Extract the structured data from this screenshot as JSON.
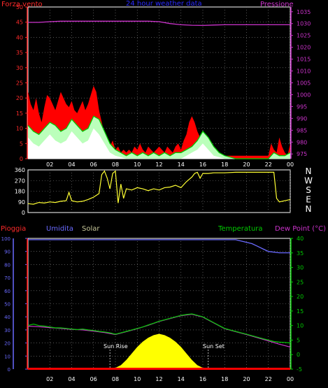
{
  "chart_data": [
    {
      "type": "line",
      "title": "24 hour weather data",
      "left_axis_label": "Forza vento",
      "right_axis_label": "Pressione",
      "x_tick_labels": [
        "02",
        "04",
        "06",
        "08",
        "10",
        "12",
        "14",
        "16",
        "18",
        "20",
        "22",
        "00"
      ],
      "left_ticks": [
        0,
        5,
        10,
        15,
        20,
        25,
        30,
        35,
        40,
        45,
        50
      ],
      "right_ticks": [
        975,
        980,
        985,
        990,
        995,
        1000,
        1005,
        1010,
        1015,
        1020,
        1025,
        1030,
        1035
      ],
      "xlim": [
        0,
        24
      ],
      "ylim_left": [
        0,
        50
      ],
      "ylim_right": [
        973,
        1037
      ],
      "grid": true,
      "colors": {
        "gust": "#ff0000",
        "average": "#00cc00",
        "min": "#ffffff",
        "pressure": "#cc33cc",
        "left_axis": "#ff2a2a",
        "right_axis": "#cc33cc",
        "title": "#2a2aff"
      },
      "series": [
        {
          "role": "gust",
          "x": [
            0,
            0.25,
            0.5,
            0.75,
            1,
            1.25,
            1.5,
            1.75,
            2,
            2.25,
            2.5,
            2.75,
            3,
            3.25,
            3.5,
            3.75,
            4,
            4.25,
            4.5,
            4.75,
            5,
            5.25,
            5.5,
            5.75,
            6,
            6.25,
            6.5,
            6.75,
            7,
            7.25,
            7.5,
            7.75,
            8,
            8.25,
            8.5,
            8.75,
            9,
            9.25,
            9.5,
            9.75,
            10,
            10.25,
            10.5,
            10.75,
            11,
            11.25,
            11.5,
            11.75,
            12,
            12.25,
            12.5,
            12.75,
            13,
            13.25,
            13.5,
            13.75,
            14,
            14.25,
            14.5,
            14.75,
            15,
            15.25,
            15.5,
            15.75,
            16,
            16.25,
            16.5,
            16.75,
            17,
            17.25,
            17.5,
            17.75,
            18,
            18.5,
            19,
            19.5,
            20,
            20.5,
            21,
            21.5,
            22,
            22.25,
            22.5,
            22.75,
            23,
            23.25,
            23.5,
            23.75,
            24
          ],
          "values": [
            22,
            18,
            16,
            20,
            15,
            12,
            17,
            21,
            20,
            18,
            16,
            19,
            22,
            20,
            18,
            17,
            19,
            16,
            15,
            17,
            19,
            16,
            18,
            21,
            24,
            22,
            16,
            12,
            8,
            5,
            4,
            6,
            3,
            4,
            2,
            3,
            2,
            3,
            2,
            4,
            3,
            5,
            3,
            2,
            4,
            3,
            2,
            3,
            4,
            3,
            2,
            4,
            3,
            2,
            4,
            5,
            3,
            6,
            8,
            12,
            14,
            12,
            9,
            7,
            6,
            5,
            3,
            2,
            1,
            1,
            1,
            1,
            1,
            1,
            1,
            1,
            1,
            1,
            1,
            1,
            1,
            5,
            3,
            2,
            7,
            4,
            2,
            1,
            5
          ]
        },
        {
          "role": "average",
          "x": [
            0,
            0.5,
            1,
            1.5,
            2,
            2.5,
            3,
            3.5,
            4,
            4.5,
            5,
            5.5,
            6,
            6.5,
            7,
            7.5,
            8,
            8.5,
            9,
            9.5,
            10,
            10.5,
            11,
            11.5,
            12,
            12.5,
            13,
            13.5,
            14,
            14.5,
            15,
            15.5,
            16,
            16.5,
            17,
            17.5,
            18,
            19,
            20,
            21,
            22,
            22.5,
            23,
            23.5,
            24
          ],
          "values": [
            11,
            9,
            8,
            10,
            12,
            11,
            9,
            10,
            13,
            11,
            9,
            10,
            14,
            13,
            9,
            5,
            3,
            2,
            1,
            2,
            1,
            2,
            1,
            2,
            1,
            2,
            1,
            2,
            2,
            3,
            4,
            6,
            9,
            7,
            4,
            2,
            1,
            0,
            0,
            0,
            0,
            2,
            1,
            1,
            2
          ]
        },
        {
          "role": "min",
          "x": [
            0,
            0.5,
            1,
            1.5,
            2,
            2.5,
            3,
            3.5,
            4,
            4.5,
            5,
            5.5,
            6,
            6.5,
            7,
            7.5,
            8,
            9,
            10,
            11,
            12,
            13,
            14,
            14.5,
            15,
            15.5,
            16,
            16.5,
            17,
            18,
            20,
            22,
            23,
            24
          ],
          "values": [
            7,
            5,
            4,
            6,
            8,
            6,
            5,
            6,
            9,
            7,
            5,
            6,
            10,
            8,
            5,
            2,
            1,
            0,
            0,
            0,
            0,
            0,
            0,
            1,
            2,
            3,
            5,
            3,
            1,
            0,
            0,
            0,
            0,
            0
          ]
        },
        {
          "role": "pressure",
          "x": [
            0,
            1,
            2,
            3,
            4,
            5,
            6,
            7,
            8,
            9,
            10,
            11,
            12,
            13,
            14,
            15,
            16,
            17,
            18,
            19,
            20,
            21,
            22,
            23,
            24
          ],
          "values": [
            1030.5,
            1030.5,
            1030.8,
            1031,
            1031,
            1031,
            1031,
            1031,
            1031,
            1031,
            1031,
            1031,
            1030.8,
            1030,
            1029.5,
            1029.3,
            1029.2,
            1029.4,
            1029.5,
            1029.5,
            1029.5,
            1029.5,
            1029.5,
            1029.5,
            1029.5
          ]
        }
      ]
    },
    {
      "type": "line",
      "side_labels": [
        "N",
        "W",
        "S",
        "E",
        "N"
      ],
      "left_ticks": [
        0,
        90,
        180,
        270,
        360
      ],
      "x_tick_labels": [
        "02",
        "04",
        "06",
        "08",
        "10",
        "12",
        "14",
        "16",
        "18",
        "20",
        "22",
        "00"
      ],
      "xlim": [
        0,
        24
      ],
      "ylim": [
        0,
        360
      ],
      "grid": true,
      "colors": {
        "direction": "#ffff33",
        "axis": "#ffffff",
        "letters": "#ffffff"
      },
      "series": [
        {
          "role": "wind_direction_degrees",
          "x": [
            0,
            0.5,
            1,
            1.5,
            2,
            2.5,
            3,
            3.5,
            3.75,
            4,
            4.5,
            5,
            5.5,
            6,
            6.5,
            6.75,
            7,
            7.25,
            7.5,
            7.75,
            8,
            8.25,
            8.5,
            8.75,
            9,
            9.5,
            10,
            10.5,
            11,
            11.5,
            12,
            12.5,
            13,
            13.5,
            14,
            14.5,
            15,
            15.25,
            15.5,
            15.75,
            16,
            16.5,
            17,
            18,
            19,
            20,
            21,
            22,
            22.5,
            22.75,
            23,
            23.5,
            24
          ],
          "values": [
            75,
            70,
            85,
            80,
            90,
            85,
            95,
            100,
            170,
            100,
            90,
            95,
            110,
            130,
            160,
            320,
            350,
            290,
            200,
            330,
            350,
            80,
            240,
            120,
            200,
            190,
            210,
            200,
            185,
            200,
            190,
            210,
            215,
            230,
            210,
            260,
            300,
            330,
            340,
            290,
            330,
            330,
            335,
            335,
            340,
            340,
            340,
            340,
            340,
            120,
            90,
            100,
            110
          ]
        }
      ]
    },
    {
      "type": "area",
      "labels": {
        "pioggia": "Pioggia",
        "umidita": "Umidita",
        "solar": "Solar",
        "temperatura": "Temperatura",
        "dew_point": "Dew Point (°C)",
        "sun_rise": "Sun Rise",
        "sun_set": "Sun Set"
      },
      "left_ticks": [
        0,
        10,
        20,
        30,
        40,
        50,
        60,
        70,
        80,
        90,
        100
      ],
      "right_ticks": [
        -5,
        0,
        5,
        10,
        15,
        20,
        25,
        30,
        35,
        40
      ],
      "x_tick_labels": [
        "02",
        "04",
        "06",
        "08",
        "10",
        "12",
        "14",
        "16",
        "18",
        "20",
        "22",
        "00"
      ],
      "xlim": [
        0,
        24
      ],
      "ylim_left": [
        0,
        100
      ],
      "ylim_right": [
        -5,
        40
      ],
      "grid": true,
      "colors": {
        "humidity": "#6a6aff",
        "temperature": "#00cc00",
        "dew_point": "#cc33cc",
        "solar": "#ffff00",
        "rain": "#ff0000",
        "pioggia_label": "#ff2a2a",
        "umidita_label": "#6a6aff",
        "solar_label": "#c8c89a",
        "temperatura_label": "#00cc00",
        "dew_label": "#cc33cc",
        "sun_text": "#ffffff"
      },
      "series": [
        {
          "role": "humidity",
          "x": [
            0,
            2,
            4,
            6,
            8,
            10,
            12,
            14,
            16,
            18,
            19,
            19.5,
            20,
            20.5,
            21,
            21.5,
            22,
            23,
            24
          ],
          "values": [
            99,
            99,
            99,
            99,
            99,
            99,
            99,
            99,
            99,
            99,
            99,
            98,
            97,
            96,
            94,
            92,
            90,
            89,
            89
          ]
        },
        {
          "role": "temperature",
          "x": [
            0,
            0.5,
            1,
            1.5,
            2,
            2.5,
            3,
            3.5,
            4,
            4.5,
            5,
            5.5,
            6,
            6.5,
            7,
            7.5,
            8,
            8.5,
            9,
            9.5,
            10,
            10.5,
            11,
            11.5,
            12,
            12.5,
            13,
            13.5,
            14,
            14.5,
            15,
            15.5,
            16,
            16.5,
            17,
            17.5,
            18,
            18.5,
            19,
            19.5,
            20,
            20.5,
            21,
            21.5,
            22,
            22.5,
            23,
            23.5,
            24
          ],
          "values": [
            10,
            10.5,
            10,
            9.8,
            9.5,
            9.2,
            9.2,
            9,
            8.8,
            8.6,
            8.8,
            8.5,
            8.3,
            8,
            7.8,
            7.5,
            7,
            7.5,
            8,
            8.5,
            9,
            9.5,
            10.2,
            10.8,
            11.5,
            12,
            12.5,
            13,
            13.5,
            13.8,
            14,
            13.5,
            13,
            12,
            11,
            10,
            9,
            8.5,
            8,
            7.5,
            7,
            6.5,
            6,
            5.5,
            5,
            4.5,
            4.3,
            4.2,
            4
          ]
        },
        {
          "role": "dew_point",
          "x": [
            0,
            1,
            2,
            3,
            4,
            5,
            6,
            7,
            8,
            9,
            10,
            11,
            12,
            13,
            14,
            15,
            16,
            17,
            18,
            19,
            20,
            21,
            22,
            23,
            24
          ],
          "values": [
            9.8,
            9.6,
            9.3,
            9,
            8.7,
            8.5,
            8.1,
            7.6,
            6.9,
            7.9,
            8.9,
            10.1,
            11.4,
            12.4,
            13.4,
            13.9,
            12.9,
            10.9,
            8.9,
            7.9,
            6.9,
            5.8,
            4.7,
            3.6,
            2.6
          ]
        },
        {
          "role": "solar",
          "x": [
            7.5,
            8,
            8.5,
            9,
            9.5,
            10,
            10.5,
            11,
            11.5,
            12,
            12.5,
            13,
            13.5,
            14,
            14.5,
            15,
            15.5,
            16,
            16.5
          ],
          "values": [
            0,
            1,
            3,
            7,
            12,
            17,
            21,
            24,
            26,
            27,
            26,
            24,
            21,
            17,
            12,
            7,
            3,
            1,
            0
          ]
        },
        {
          "role": "rain",
          "x": [
            0,
            24
          ],
          "values": [
            0,
            0
          ]
        }
      ]
    }
  ]
}
